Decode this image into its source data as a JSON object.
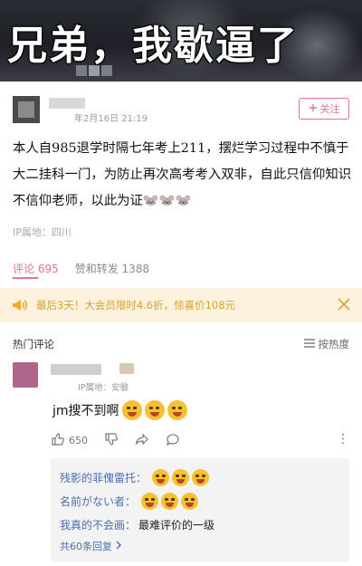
{
  "banner": {
    "text": "兄弟，我歇逼了"
  },
  "post": {
    "date": "年2月16日 21:19",
    "follow_label": "关注",
    "body": "本人自985退学时隔七年考上211，摆烂学习过程中不慎于大二挂科一门，为防止再次高考考入双非，自此只信仰知识不信仰老师，以此为证",
    "body_emoji": "🐭🐭🐭",
    "ip": "IP属地：四川"
  },
  "tabs": {
    "comments": "评论 695",
    "likes_reposts": "赞和转发 1388"
  },
  "promo": {
    "text": "最后3天！大会员限时4.6折，惊喜价108元",
    "accent_color": "#e0a030"
  },
  "comments_section": {
    "title": "热门评论",
    "sort_label": "按热度"
  },
  "comment": {
    "meta": "IP属地：安徽",
    "text": "jm搜不到啊",
    "like_count": "650"
  },
  "replies": [
    {
      "user": "残影的菲傀雷托：",
      "text": ""
    },
    {
      "user": "名前がない者：",
      "text": ""
    },
    {
      "user": "我真的不会画：",
      "text": "最难评价的一级"
    }
  ],
  "replies_more": "共60条回复",
  "colors": {
    "accent_pink": "#e8728f",
    "link_blue": "#4a6fb1"
  }
}
